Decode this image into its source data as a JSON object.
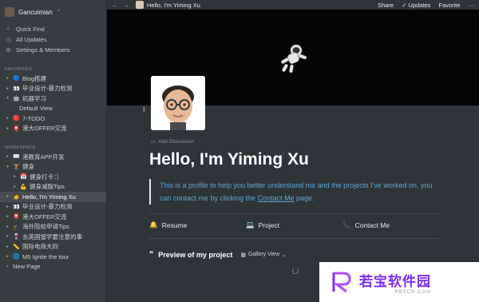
{
  "sidebar": {
    "workspace_name": "Gancuimian",
    "nav": [
      {
        "icon": "search-icon",
        "label": "Quick Find"
      },
      {
        "icon": "clock-icon",
        "label": "All Updates"
      },
      {
        "icon": "gear-icon",
        "label": "Settings & Members"
      }
    ],
    "favorites_heading": "FAVORITES",
    "favorites": [
      {
        "emoji": "🔵",
        "label": "Blog搭建",
        "toggle": "▸"
      },
      {
        "emoji": "👀",
        "label": "毕业设计-暴力检测",
        "toggle": "▸"
      },
      {
        "emoji": "🤖",
        "label": "机器学习",
        "toggle": "▾"
      },
      {
        "emoji": "",
        "label": "Default View",
        "toggle": ""
      },
      {
        "emoji": "🔴",
        "label": "7-TODO",
        "toggle": "▸"
      },
      {
        "emoji": "📮",
        "label": "港大OFFER交流",
        "toggle": "▸"
      }
    ],
    "workspace_heading": "WORKSPACE",
    "workspace_pages": [
      {
        "emoji": "📖",
        "label": "港教育APP开发",
        "toggle": "▸",
        "level": 1
      },
      {
        "emoji": "🏋",
        "label": "健身",
        "toggle": "▾",
        "level": 1
      },
      {
        "emoji": "📅",
        "label": "健身打卡：）",
        "toggle": "▸",
        "level": 2
      },
      {
        "emoji": "💪",
        "label": "健身减脂Tips",
        "toggle": "▸",
        "level": 2
      },
      {
        "emoji": "🧑",
        "label": "Hello, I'm Yiming Xu",
        "toggle": "▸",
        "level": 1,
        "active": true
      },
      {
        "emoji": "👀",
        "label": "毕业设计-暴力检测",
        "toggle": "▸",
        "level": 1
      },
      {
        "emoji": "📮",
        "label": "港大OFFER交流",
        "toggle": "▸",
        "level": 1
      },
      {
        "emoji": "🎓",
        "label": "海外院校申请Tips",
        "toggle": "▸",
        "level": 1
      },
      {
        "emoji": "🍷",
        "label": "去英国留学要注意的事",
        "toggle": "▸",
        "level": 1
      },
      {
        "emoji": "📏",
        "label": "国际电商大四",
        "toggle": "▸",
        "level": 1
      },
      {
        "emoji": "🌐",
        "label": "M5 Ignite the tour",
        "toggle": "▸",
        "level": 1
      },
      {
        "emoji": "",
        "label": "New Page",
        "toggle": "+",
        "level": 1
      }
    ]
  },
  "topbar": {
    "breadcrumb": "Hello, I'm Yiming Xu",
    "share": "Share",
    "updates": "Updates",
    "favorite": "Favorite"
  },
  "page": {
    "add_discussion": "Add Discussion",
    "title": "Hello, I'm Yiming Xu",
    "quote_before": "This is a profile to help you better understand me and the projects I've worked on, you can contact me by clicking the ",
    "quote_link": "Contact Me",
    "quote_after": " page.",
    "columns": [
      {
        "emoji": "🔔",
        "label": "Resume"
      },
      {
        "emoji": "💻",
        "label": "Project"
      },
      {
        "emoji": "📞",
        "label": "Contact Me"
      }
    ],
    "preview_label": "Preview of my project",
    "gallery_view": "Gallery View"
  },
  "watermark": {
    "text": "若宝软件园",
    "url": "RBSCN.COM"
  },
  "colors": {
    "sidebar_bg": "#373c3f",
    "page_bg": "#2f3437",
    "quote_text": "#5aa7d9",
    "watermark_text": "#7b2ff7"
  }
}
